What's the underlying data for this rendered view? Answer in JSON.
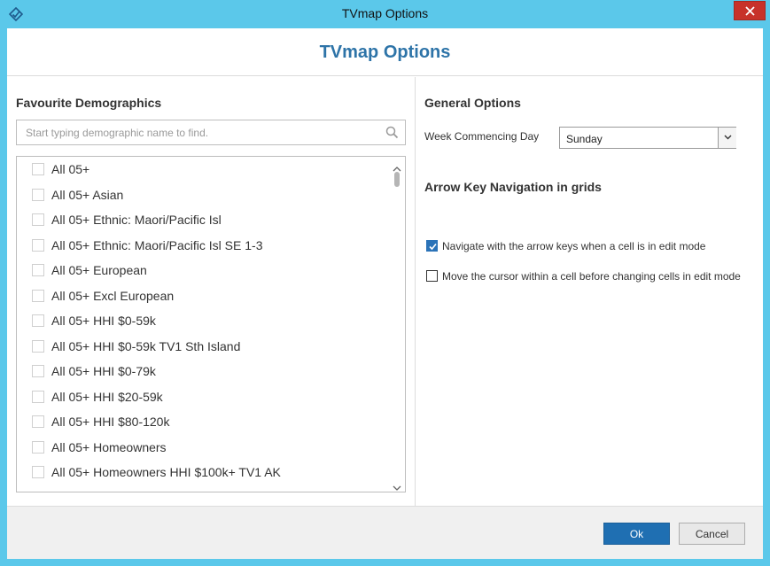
{
  "window": {
    "title": "TVmap Options",
    "app_icon": "tvmap-logo-icon",
    "close_icon": "close-icon"
  },
  "header": {
    "title": "TVmap Options",
    "title_color": "#2e74a8"
  },
  "favourites": {
    "title": "Favourite Demographics",
    "search_placeholder": "Start typing demographic name to find.",
    "search_icon": "search-icon",
    "items": [
      {
        "label": "All 05+",
        "checked": false
      },
      {
        "label": "All 05+ Asian",
        "checked": false
      },
      {
        "label": "All 05+ Ethnic: Maori/Pacific Isl",
        "checked": false
      },
      {
        "label": "All 05+ Ethnic: Maori/Pacific Isl SE 1-3",
        "checked": false
      },
      {
        "label": "All 05+ European",
        "checked": false
      },
      {
        "label": "All 05+ Excl European",
        "checked": false
      },
      {
        "label": "All 05+ HHI $0-59k",
        "checked": false
      },
      {
        "label": "All 05+ HHI $0-59k TV1 Sth Island",
        "checked": false
      },
      {
        "label": "All 05+ HHI $0-79k",
        "checked": false
      },
      {
        "label": "All 05+ HHI $20-59k",
        "checked": false
      },
      {
        "label": "All 05+ HHI $80-120k",
        "checked": false
      },
      {
        "label": "All 05+ Homeowners",
        "checked": false
      },
      {
        "label": "All 05+ Homeowners HHI $100k+ TV1 AK",
        "checked": false
      }
    ]
  },
  "general": {
    "title": "General Options",
    "week_label": "Week Commencing Day",
    "week_value": "Sunday"
  },
  "arrow_nav": {
    "title": "Arrow Key Navigation in grids",
    "options": [
      {
        "label": "Navigate with the arrow keys when a cell is in edit mode",
        "checked": true
      },
      {
        "label": "Move the cursor within a cell before changing cells in edit mode",
        "checked": false
      }
    ]
  },
  "footer": {
    "ok_label": "Ok",
    "cancel_label": "Cancel",
    "accent": "#1f6fb2"
  }
}
